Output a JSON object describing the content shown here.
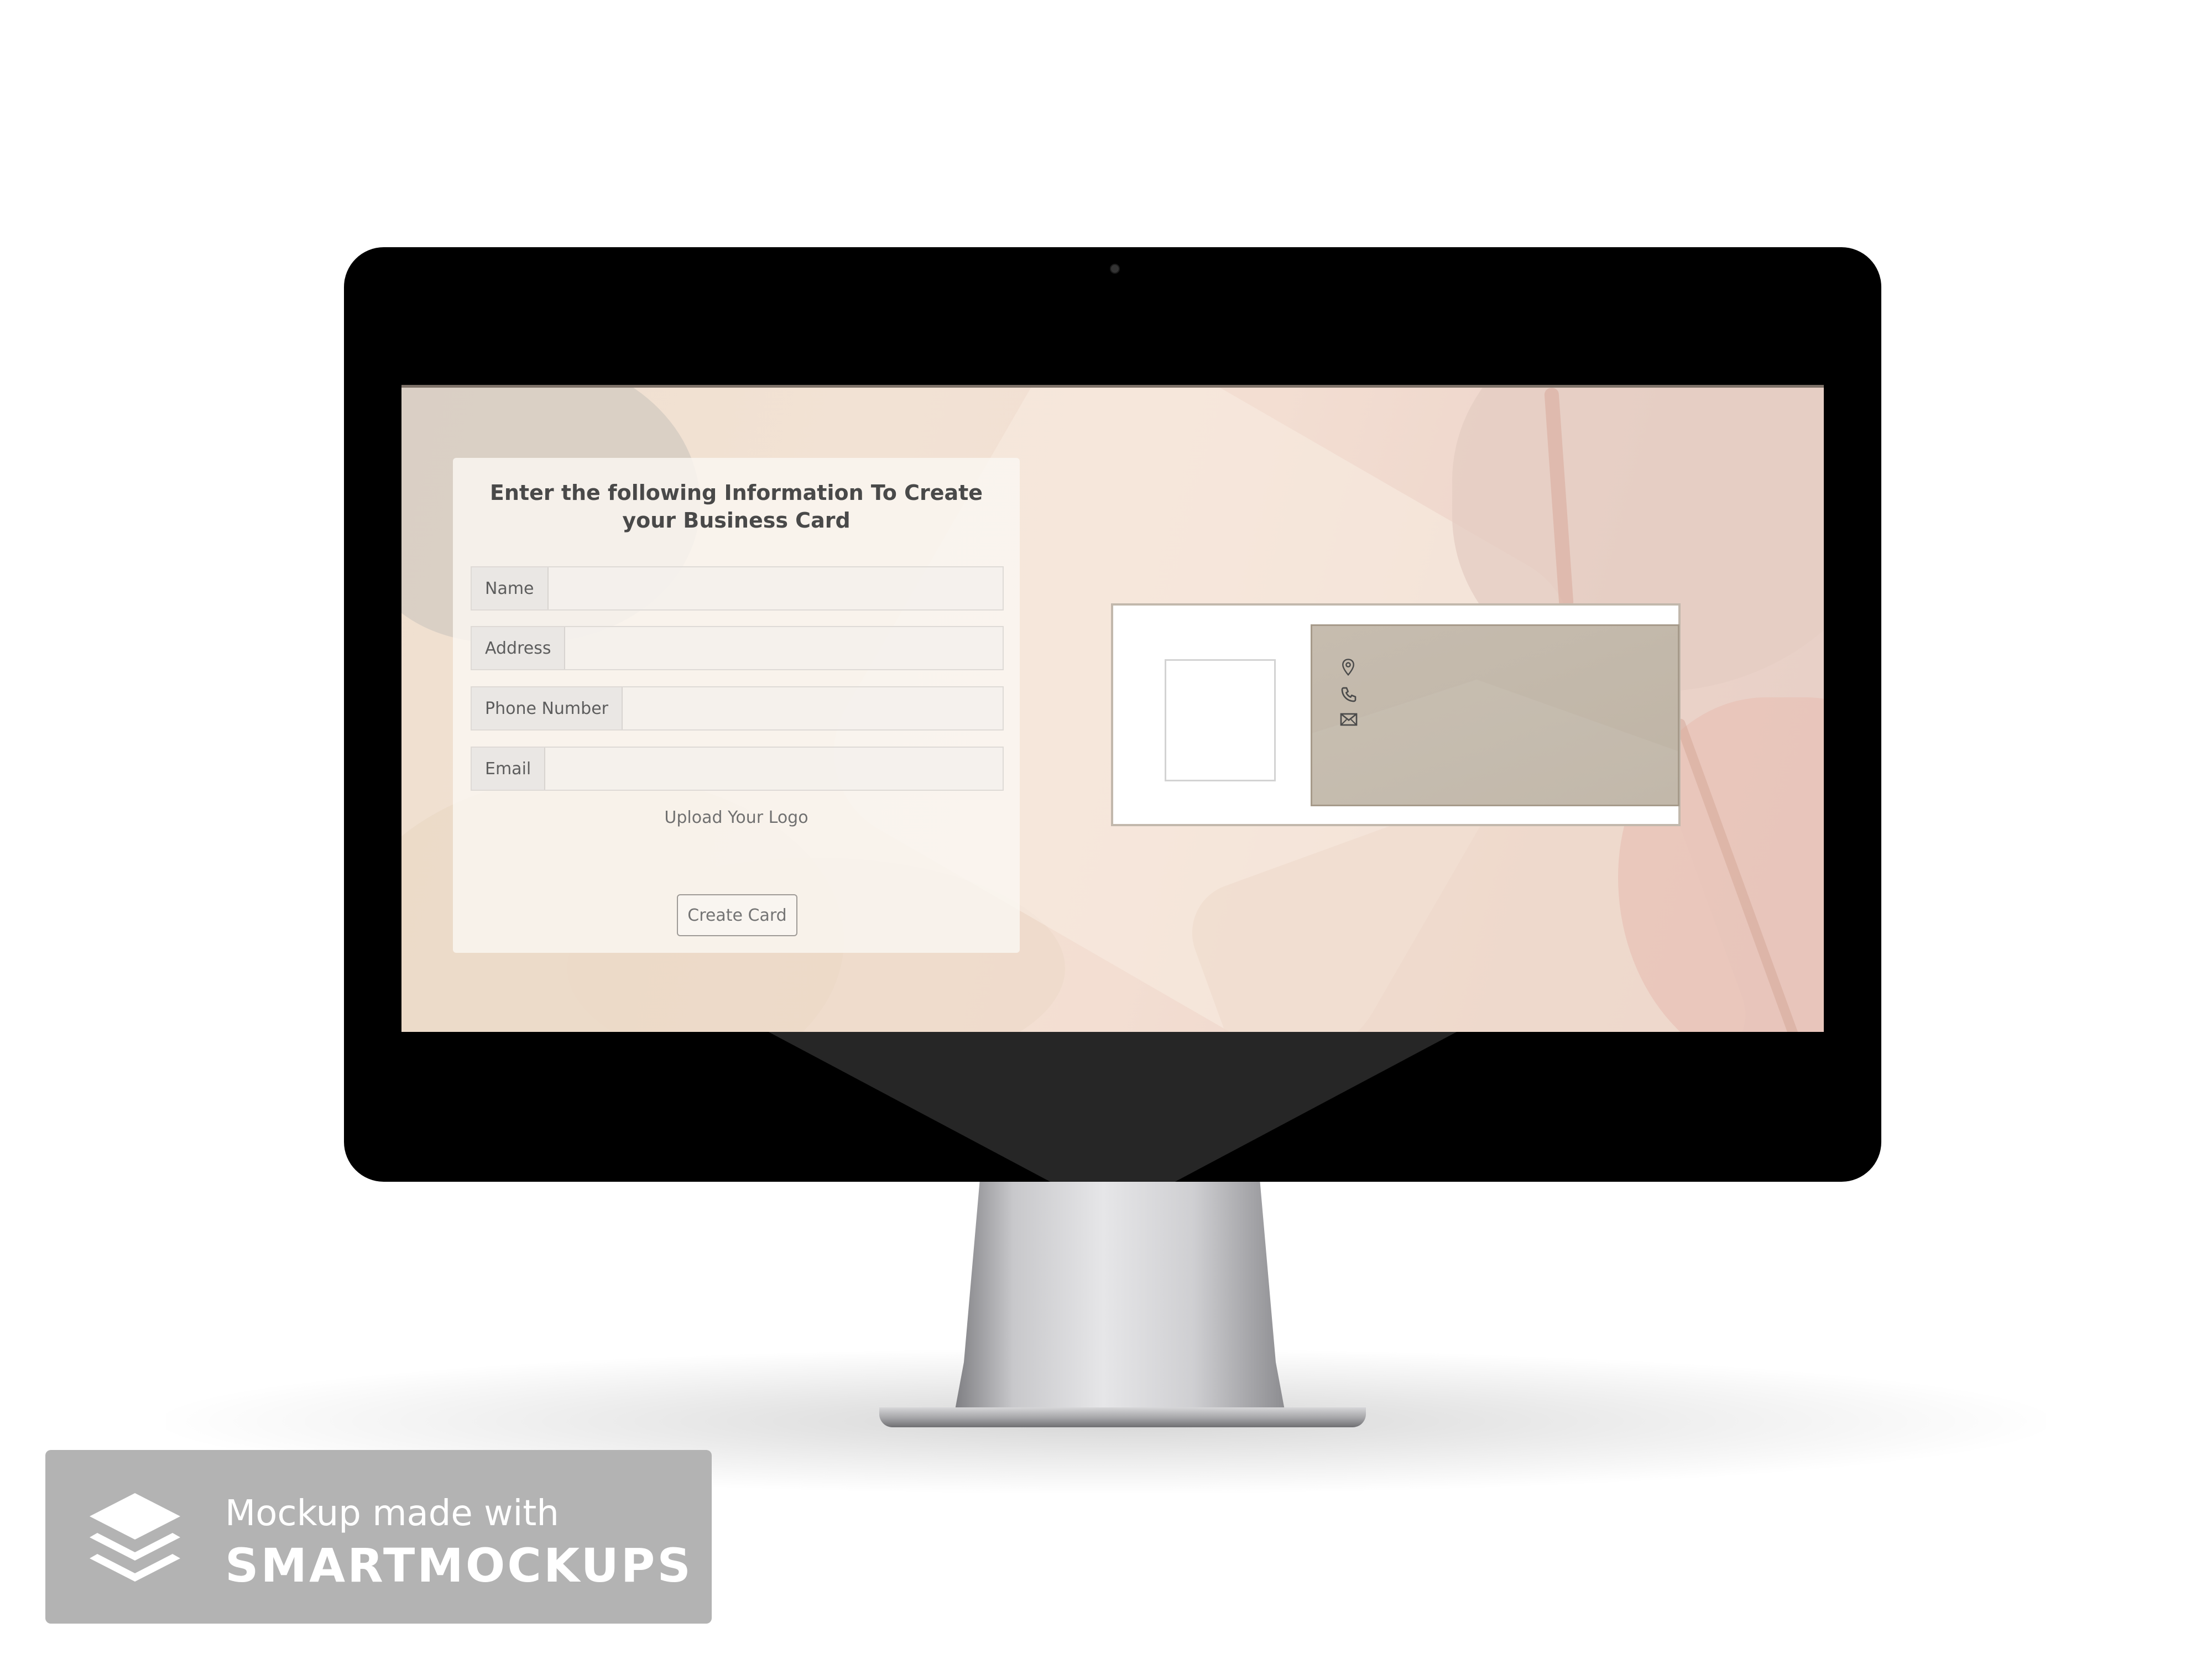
{
  "form": {
    "title": "Enter the following Information To Create your Business Card",
    "fields": [
      {
        "label": "Name",
        "value": ""
      },
      {
        "label": "Address",
        "value": ""
      },
      {
        "label": "Phone Number",
        "value": ""
      },
      {
        "label": "Email",
        "value": ""
      }
    ],
    "upload_label": "Upload Your Logo",
    "submit_label": "Create Card"
  },
  "card_preview": {
    "icons": [
      "location-pin-icon",
      "phone-icon",
      "envelope-icon"
    ],
    "accent_color": "#c4baac"
  },
  "watermark": {
    "line1": "Mockup made with",
    "line2": "SMARTMOCKUPS"
  }
}
